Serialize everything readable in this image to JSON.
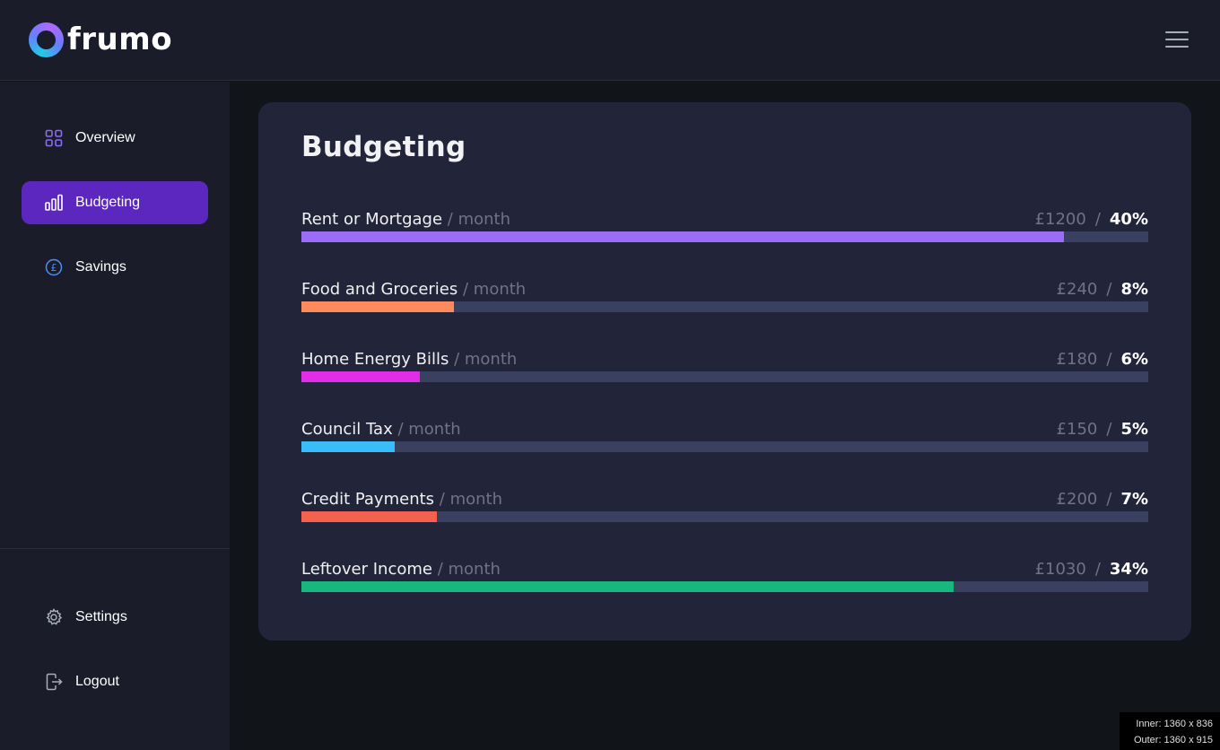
{
  "header": {
    "logo_text": "frumo",
    "menu_icon": "hamburger-menu-icon"
  },
  "sidebar": {
    "items": [
      {
        "label": "Overview",
        "icon": "grid-icon",
        "active": false
      },
      {
        "label": "Budgeting",
        "icon": "bar-chart-icon",
        "active": true
      },
      {
        "label": "Savings",
        "icon": "pound-coin-icon",
        "active": false
      }
    ],
    "bottom_items": [
      {
        "label": "Settings",
        "icon": "gear-icon"
      },
      {
        "label": "Logout",
        "icon": "logout-icon"
      }
    ]
  },
  "main": {
    "title": "Budgeting",
    "rows": [
      {
        "label": "Rent or Mortgage",
        "period": "/ month",
        "amount": "£1200",
        "percent": "40%",
        "fill": 0.9,
        "color": "#9a6cf7"
      },
      {
        "label": "Food and Groceries",
        "period": "/ month",
        "amount": "£240",
        "percent": "8%",
        "fill": 0.18,
        "color": "#ff8a5c"
      },
      {
        "label": "Home Energy Bills",
        "period": "/ month",
        "amount": "£180",
        "percent": "6%",
        "fill": 0.14,
        "color": "#e22de8"
      },
      {
        "label": "Council Tax",
        "period": "/ month",
        "amount": "£150",
        "percent": "5%",
        "fill": 0.11,
        "color": "#38bdf8"
      },
      {
        "label": "Credit Payments",
        "period": "/ month",
        "amount": "£200",
        "percent": "7%",
        "fill": 0.16,
        "color": "#f5614f"
      },
      {
        "label": "Leftover Income",
        "period": "/ month",
        "amount": "£1030",
        "percent": "34%",
        "fill": 0.77,
        "color": "#16b87e"
      }
    ]
  },
  "viewport_badge": {
    "inner": "Inner: 1360 x 836",
    "outer": "Outer: 1360 x 915"
  },
  "colors": {
    "accent": "#5b27bf",
    "background": "#111418",
    "panel": "#1a1d29",
    "card": "#222539"
  }
}
